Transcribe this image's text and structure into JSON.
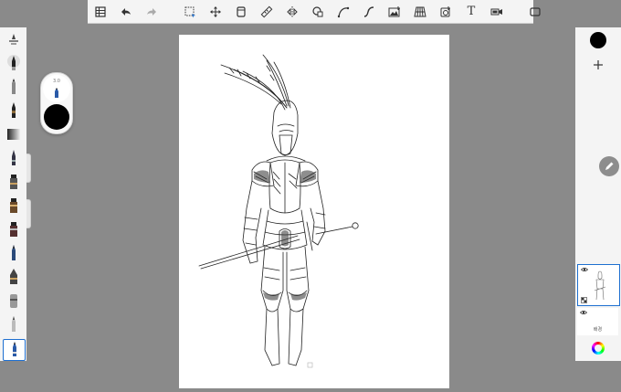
{
  "toolbar": {
    "icons": [
      "gallery-icon",
      "undo-icon",
      "redo-icon",
      "select-icon",
      "transform-icon",
      "layer-copy-icon",
      "ruler-icon",
      "symmetry-icon",
      "shapes-icon",
      "curve-icon",
      "stroke-icon",
      "image-icon",
      "perspective-icon",
      "fill-icon",
      "text-icon",
      "video-icon",
      "fullscreen-icon"
    ],
    "text_tool_glyph": "T"
  },
  "brush_puck": {
    "size_value": "3.0"
  },
  "layers": {
    "background_label": "배경"
  },
  "colors": {
    "accent": "#1e6fd0",
    "primary_color": "#000000",
    "ui_background": "#8a8a8a",
    "panel": "#f4f4f4"
  }
}
